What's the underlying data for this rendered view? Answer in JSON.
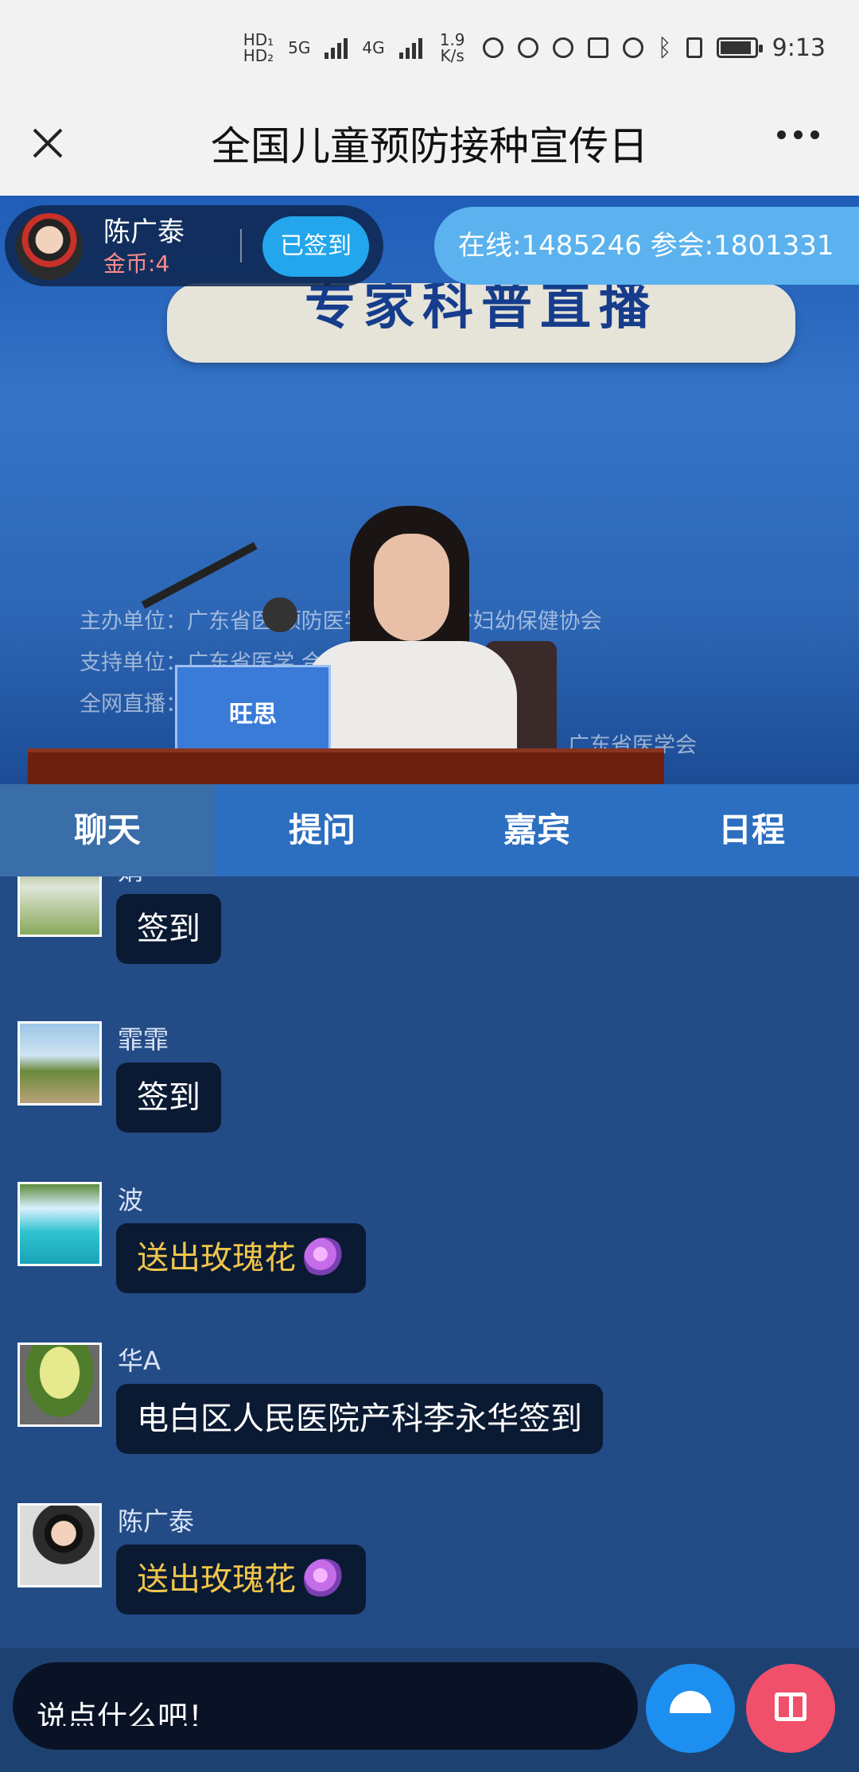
{
  "status_bar": {
    "network_1": "HD₁",
    "network_2": "HD₂",
    "gen_a": "5G",
    "gen_b": "4G",
    "speed": "1.9 K/s",
    "time": "9:13"
  },
  "titlebar": {
    "title": "全国儿童预防接种宣传日"
  },
  "live_header": {
    "user_name": "陈广泰",
    "coins": "金币:4",
    "signed_label": "已签到",
    "online_text": "在线:1485246  参会:1801331"
  },
  "video": {
    "banner_text": "专家科普直播",
    "organizer_line": "主办单位：广东省医  预防医学会、广东省妇幼保健协会",
    "support_line": "支持单位：广东省医学    合生元",
    "broadcast_line": "全网直播：        南方卫视、健康广东、触电新",
    "bottom_line": "理、广东省医学会",
    "desk_sign": "旺思"
  },
  "tabs": [
    {
      "label": "聊天",
      "active": true
    },
    {
      "label": "提问",
      "active": false
    },
    {
      "label": "嘉宾",
      "active": false
    },
    {
      "label": "日程",
      "active": false
    }
  ],
  "messages": [
    {
      "nick": "娟",
      "text": "签到",
      "gift": false,
      "avatar": "rabbit-avatar"
    },
    {
      "nick": "霏霏",
      "text": "签到",
      "gift": false,
      "avatar": "tree-avatar"
    },
    {
      "nick": "波",
      "text": "送出玫瑰花",
      "gift": true,
      "avatar": "waterfall-avatar"
    },
    {
      "nick": "华A",
      "text": "电白区人民医院产科李永华签到",
      "gift": false,
      "avatar": "bush-avatar"
    },
    {
      "nick": "陈广泰",
      "text": "送出玫瑰花",
      "gift": true,
      "avatar": "man-avatar"
    }
  ],
  "composer": {
    "placeholder": "说点什么吧！"
  },
  "colors": {
    "chat_bg": "#234b86",
    "tab_bar": "#2c6ec0",
    "gift_text": "#f0c54a",
    "fab_blue": "#1d8ff0",
    "fab_red": "#f0506a"
  }
}
